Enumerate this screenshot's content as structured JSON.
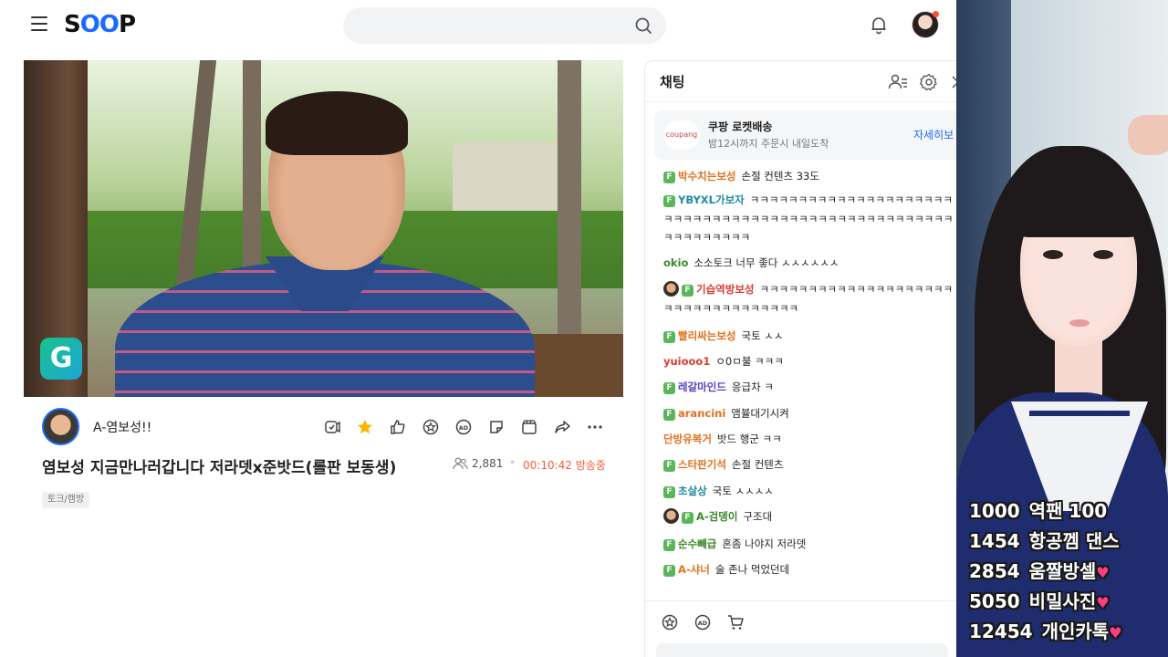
{
  "header": {
    "logo_text_1": "S",
    "logo_text_2": "OO",
    "logo_text_3": "P",
    "search_placeholder": ""
  },
  "stream": {
    "streamer_name": "A-염보성!!",
    "title": "염보성 지금만나러갑니다 저라뎃x준밧드(롤판 보동생)",
    "viewers": "2,881",
    "separator": "•",
    "elapsed": "00:10:42 방송중",
    "tag": "토크/캠방",
    "video_badge": "G"
  },
  "chat": {
    "title": "채팅",
    "ad": {
      "logo": "coupang",
      "title": "쿠팡 로켓배송",
      "subtitle": "밤12시까지 주문시 내일도착",
      "link": "자세히보"
    },
    "messages": [
      {
        "nick": "박수치는보성",
        "text": "손절 컨텐츠 33도",
        "badge": "F",
        "color": "orange",
        "avatar": false
      },
      {
        "nick": "YBYXL가보자",
        "text": "ㅋㅋㅋㅋㅋㅋㅋㅋㅋㅋㅋㅋㅋㅋㅋㅋㅋㅋㅋㅋㅋㅋㅋㅋㅋㅋㅋㅋㅋㅋㅋㅋㅋㅋㅋㅋㅋㅋㅋㅋㅋㅋㅋㅋㅋㅋㅋㅋㅋㅋㅋㅋㅋㅋㅋㅋㅋㅋㅋㅋ",
        "badge": "F",
        "color": "teal",
        "avatar": false
      },
      {
        "nick": "okio",
        "text": "소소토크 너무 좋다 ㅅㅅㅅㅅㅅㅅ",
        "badge": "",
        "color": "green",
        "avatar": false
      },
      {
        "nick": "기습역방보성",
        "text": "ㅋㅋㅋㅋㅋㅋㅋㅋㅋㅋㅋㅋㅋㅋㅋㅋㅋㅋㅋㅋㅋㅋㅋㅋㅋㅋㅋㅋㅋㅋㅋㅋㅋㅋ",
        "badge": "F",
        "color": "red",
        "avatar": true
      },
      {
        "nick": "빨리싸는보성",
        "text": "국토 ㅅㅅ",
        "badge": "F",
        "color": "orange",
        "avatar": false
      },
      {
        "nick": "yuiooo1",
        "text": "ㅇ0ㅁ불 ㅋㅋㅋ",
        "badge": "",
        "color": "red",
        "avatar": false
      },
      {
        "nick": "레갈마인드",
        "text": "응급차 ㅋ",
        "badge": "F",
        "color": "purple",
        "avatar": false
      },
      {
        "nick": "arancini",
        "text": "앰뷸대기시켜",
        "badge": "F",
        "color": "orange",
        "avatar": false
      },
      {
        "nick": "단방유복거",
        "text": "밧드 행군 ㅋㅋ",
        "badge": "",
        "color": "orange",
        "avatar": false
      },
      {
        "nick": "스타판기석",
        "text": "손절 컨텐츠",
        "badge": "F",
        "color": "orange",
        "avatar": false
      },
      {
        "nick": "초살상",
        "text": "국토 ㅅㅅㅅㅅ",
        "badge": "F",
        "color": "teal",
        "avatar": false
      },
      {
        "nick": "A-검뎅이",
        "text": "구조대",
        "badge": "F",
        "color": "green",
        "avatar": true
      },
      {
        "nick": "순수빼급",
        "text": "혼좀 나야지 저라뎃",
        "badge": "F",
        "color": "green",
        "avatar": false
      },
      {
        "nick": "A-샤너",
        "text": "술 존나 먹었던데",
        "badge": "F",
        "color": "orange",
        "avatar": false
      }
    ]
  },
  "donations": [
    {
      "amount": "1000",
      "label": "역팬 100",
      "heart": false
    },
    {
      "amount": "1454",
      "label": "항공껨 댄스",
      "heart": false
    },
    {
      "amount": "2854",
      "label": "움짤방셀",
      "heart": true
    },
    {
      "amount": "5050",
      "label": "비밀사진",
      "heart": true
    },
    {
      "amount": "12454",
      "label": "개인카톡",
      "heart": true
    }
  ],
  "colors": {
    "accent": "#1a6bff",
    "live": "#ff5a36",
    "badge_green": "#5bb65a"
  },
  "icons": [
    "hamburger-icon",
    "search-icon",
    "bell-icon",
    "chat-user-list-icon",
    "gear-icon",
    "close-icon",
    "viewers-icon",
    "star-icon",
    "like-icon",
    "share-icon",
    "more-icon",
    "cart-icon"
  ]
}
